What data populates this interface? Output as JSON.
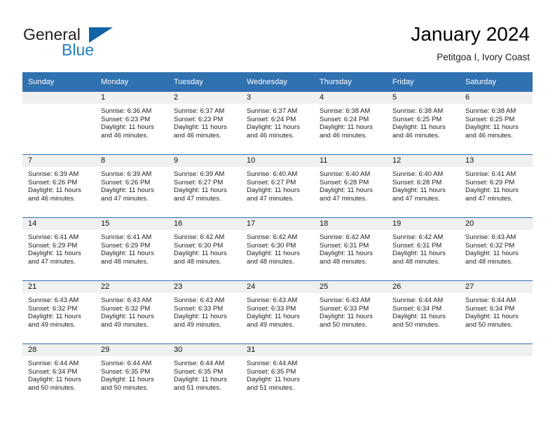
{
  "brand": {
    "name_line1": "General",
    "name_line2": "Blue",
    "flag_icon": "triangle-flag-icon",
    "accent_color": "#1163a6",
    "blue_text_color": "#1f7fc4"
  },
  "header": {
    "title": "January 2024",
    "subtitle": "Petitgoa I, Ivory Coast"
  },
  "calendar": {
    "header_bg_color": "#3071b0",
    "daynum_band_color": "#f0f0f0",
    "weekday_headers": [
      "Sunday",
      "Monday",
      "Tuesday",
      "Wednesday",
      "Thursday",
      "Friday",
      "Saturday"
    ],
    "weeks": [
      [
        {
          "day": "",
          "sunrise": "",
          "sunset": "",
          "daylight": ""
        },
        {
          "day": "1",
          "sunrise": "Sunrise: 6:36 AM",
          "sunset": "Sunset: 6:23 PM",
          "daylight": "Daylight: 11 hours and 46 minutes."
        },
        {
          "day": "2",
          "sunrise": "Sunrise: 6:37 AM",
          "sunset": "Sunset: 6:23 PM",
          "daylight": "Daylight: 11 hours and 46 minutes."
        },
        {
          "day": "3",
          "sunrise": "Sunrise: 6:37 AM",
          "sunset": "Sunset: 6:24 PM",
          "daylight": "Daylight: 11 hours and 46 minutes."
        },
        {
          "day": "4",
          "sunrise": "Sunrise: 6:38 AM",
          "sunset": "Sunset: 6:24 PM",
          "daylight": "Daylight: 11 hours and 46 minutes."
        },
        {
          "day": "5",
          "sunrise": "Sunrise: 6:38 AM",
          "sunset": "Sunset: 6:25 PM",
          "daylight": "Daylight: 11 hours and 46 minutes."
        },
        {
          "day": "6",
          "sunrise": "Sunrise: 6:38 AM",
          "sunset": "Sunset: 6:25 PM",
          "daylight": "Daylight: 11 hours and 46 minutes."
        }
      ],
      [
        {
          "day": "7",
          "sunrise": "Sunrise: 6:39 AM",
          "sunset": "Sunset: 6:26 PM",
          "daylight": "Daylight: 11 hours and 46 minutes."
        },
        {
          "day": "8",
          "sunrise": "Sunrise: 6:39 AM",
          "sunset": "Sunset: 6:26 PM",
          "daylight": "Daylight: 11 hours and 47 minutes."
        },
        {
          "day": "9",
          "sunrise": "Sunrise: 6:39 AM",
          "sunset": "Sunset: 6:27 PM",
          "daylight": "Daylight: 11 hours and 47 minutes."
        },
        {
          "day": "10",
          "sunrise": "Sunrise: 6:40 AM",
          "sunset": "Sunset: 6:27 PM",
          "daylight": "Daylight: 11 hours and 47 minutes."
        },
        {
          "day": "11",
          "sunrise": "Sunrise: 6:40 AM",
          "sunset": "Sunset: 6:28 PM",
          "daylight": "Daylight: 11 hours and 47 minutes."
        },
        {
          "day": "12",
          "sunrise": "Sunrise: 6:40 AM",
          "sunset": "Sunset: 6:28 PM",
          "daylight": "Daylight: 11 hours and 47 minutes."
        },
        {
          "day": "13",
          "sunrise": "Sunrise: 6:41 AM",
          "sunset": "Sunset: 6:29 PM",
          "daylight": "Daylight: 11 hours and 47 minutes."
        }
      ],
      [
        {
          "day": "14",
          "sunrise": "Sunrise: 6:41 AM",
          "sunset": "Sunset: 6:29 PM",
          "daylight": "Daylight: 11 hours and 47 minutes."
        },
        {
          "day": "15",
          "sunrise": "Sunrise: 6:41 AM",
          "sunset": "Sunset: 6:29 PM",
          "daylight": "Daylight: 11 hours and 48 minutes."
        },
        {
          "day": "16",
          "sunrise": "Sunrise: 6:42 AM",
          "sunset": "Sunset: 6:30 PM",
          "daylight": "Daylight: 11 hours and 48 minutes."
        },
        {
          "day": "17",
          "sunrise": "Sunrise: 6:42 AM",
          "sunset": "Sunset: 6:30 PM",
          "daylight": "Daylight: 11 hours and 48 minutes."
        },
        {
          "day": "18",
          "sunrise": "Sunrise: 6:42 AM",
          "sunset": "Sunset: 6:31 PM",
          "daylight": "Daylight: 11 hours and 48 minutes."
        },
        {
          "day": "19",
          "sunrise": "Sunrise: 6:42 AM",
          "sunset": "Sunset: 6:31 PM",
          "daylight": "Daylight: 11 hours and 48 minutes."
        },
        {
          "day": "20",
          "sunrise": "Sunrise: 6:43 AM",
          "sunset": "Sunset: 6:32 PM",
          "daylight": "Daylight: 11 hours and 48 minutes."
        }
      ],
      [
        {
          "day": "21",
          "sunrise": "Sunrise: 6:43 AM",
          "sunset": "Sunset: 6:32 PM",
          "daylight": "Daylight: 11 hours and 49 minutes."
        },
        {
          "day": "22",
          "sunrise": "Sunrise: 6:43 AM",
          "sunset": "Sunset: 6:32 PM",
          "daylight": "Daylight: 11 hours and 49 minutes."
        },
        {
          "day": "23",
          "sunrise": "Sunrise: 6:43 AM",
          "sunset": "Sunset: 6:33 PM",
          "daylight": "Daylight: 11 hours and 49 minutes."
        },
        {
          "day": "24",
          "sunrise": "Sunrise: 6:43 AM",
          "sunset": "Sunset: 6:33 PM",
          "daylight": "Daylight: 11 hours and 49 minutes."
        },
        {
          "day": "25",
          "sunrise": "Sunrise: 6:43 AM",
          "sunset": "Sunset: 6:33 PM",
          "daylight": "Daylight: 11 hours and 50 minutes."
        },
        {
          "day": "26",
          "sunrise": "Sunrise: 6:44 AM",
          "sunset": "Sunset: 6:34 PM",
          "daylight": "Daylight: 11 hours and 50 minutes."
        },
        {
          "day": "27",
          "sunrise": "Sunrise: 6:44 AM",
          "sunset": "Sunset: 6:34 PM",
          "daylight": "Daylight: 11 hours and 50 minutes."
        }
      ],
      [
        {
          "day": "28",
          "sunrise": "Sunrise: 6:44 AM",
          "sunset": "Sunset: 6:34 PM",
          "daylight": "Daylight: 11 hours and 50 minutes."
        },
        {
          "day": "29",
          "sunrise": "Sunrise: 6:44 AM",
          "sunset": "Sunset: 6:35 PM",
          "daylight": "Daylight: 11 hours and 50 minutes."
        },
        {
          "day": "30",
          "sunrise": "Sunrise: 6:44 AM",
          "sunset": "Sunset: 6:35 PM",
          "daylight": "Daylight: 11 hours and 51 minutes."
        },
        {
          "day": "31",
          "sunrise": "Sunrise: 6:44 AM",
          "sunset": "Sunset: 6:35 PM",
          "daylight": "Daylight: 11 hours and 51 minutes."
        },
        {
          "day": "",
          "sunrise": "",
          "sunset": "",
          "daylight": ""
        },
        {
          "day": "",
          "sunrise": "",
          "sunset": "",
          "daylight": ""
        },
        {
          "day": "",
          "sunrise": "",
          "sunset": "",
          "daylight": ""
        }
      ]
    ]
  }
}
